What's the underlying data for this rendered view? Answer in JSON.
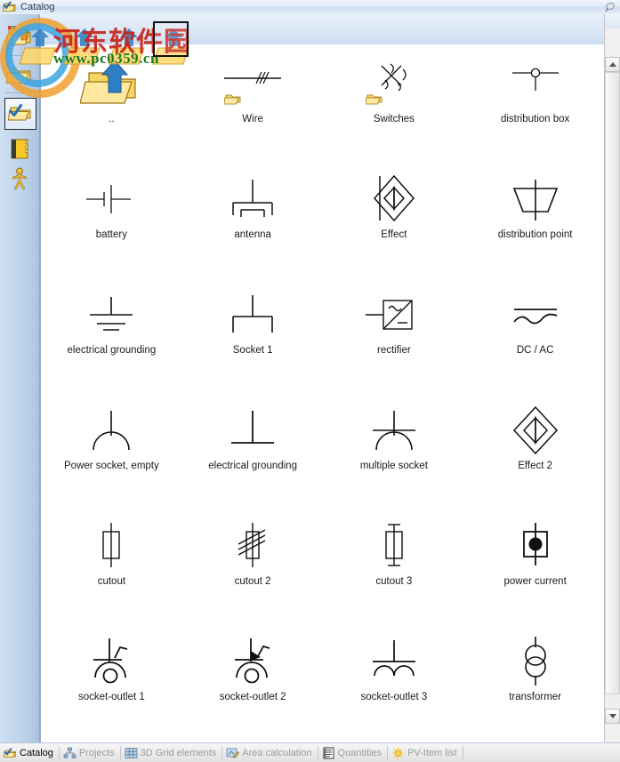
{
  "window": {
    "title": "Catalog",
    "title_icon": "folder-check-icon",
    "help_icon": "help-pointer-icon"
  },
  "sidebar": {
    "items": [
      {
        "name": "import-folder",
        "icon": "folder-import-icon",
        "selected": false
      },
      {
        "name": "open-folder",
        "icon": "folder-open-icon",
        "selected": false
      },
      {
        "name": "catalog",
        "icon": "folder-check-icon",
        "selected": true
      },
      {
        "name": "book",
        "icon": "book-icon",
        "selected": false
      },
      {
        "name": "person",
        "icon": "person-icon",
        "selected": false
      }
    ]
  },
  "catalog": {
    "items": [
      {
        "label": "..",
        "symbol": "parent-folder",
        "badge": false
      },
      {
        "label": "Wire",
        "symbol": "wire",
        "badge": true
      },
      {
        "label": "Switches",
        "symbol": "switches",
        "badge": true
      },
      {
        "label": "distribution box",
        "symbol": "distribution-box",
        "badge": false
      },
      {
        "label": "battery",
        "symbol": "battery",
        "badge": false
      },
      {
        "label": "antenna",
        "symbol": "antenna",
        "badge": false
      },
      {
        "label": "Effect",
        "symbol": "effect",
        "badge": false
      },
      {
        "label": "distribution point",
        "symbol": "distribution-point",
        "badge": false
      },
      {
        "label": "electrical grounding",
        "symbol": "electrical-grounding",
        "badge": false
      },
      {
        "label": "Socket 1",
        "symbol": "socket-1",
        "badge": false
      },
      {
        "label": "rectifier",
        "symbol": "rectifier",
        "badge": false
      },
      {
        "label": "DC / AC",
        "symbol": "dc-ac",
        "badge": false
      },
      {
        "label": "Power socket, empty",
        "symbol": "power-socket-empty",
        "badge": false
      },
      {
        "label": "electrical grounding",
        "symbol": "electrical-grounding-2",
        "badge": false
      },
      {
        "label": "multiple socket",
        "symbol": "multiple-socket",
        "badge": false
      },
      {
        "label": "Effect 2",
        "symbol": "effect-2",
        "badge": false
      },
      {
        "label": "cutout",
        "symbol": "cutout",
        "badge": false
      },
      {
        "label": "cutout 2",
        "symbol": "cutout-2",
        "badge": false
      },
      {
        "label": "cutout 3",
        "symbol": "cutout-3",
        "badge": false
      },
      {
        "label": "power current",
        "symbol": "power-current",
        "badge": false
      },
      {
        "label": "socket-outlet 1",
        "symbol": "socket-outlet-1",
        "badge": false
      },
      {
        "label": "socket-outlet 2",
        "symbol": "socket-outlet-2",
        "badge": false
      },
      {
        "label": "socket-outlet 3",
        "symbol": "socket-outlet-3",
        "badge": false
      },
      {
        "label": "transformer",
        "symbol": "transformer",
        "badge": false
      }
    ]
  },
  "scrollbar": {
    "up_arrow": "▲",
    "down_arrow": "▼"
  },
  "tabs": [
    {
      "label": "Catalog",
      "icon": "folder-check-icon",
      "active": true
    },
    {
      "label": "Projects",
      "icon": "hierarchy-icon",
      "active": false
    },
    {
      "label": "3D Grid elements",
      "icon": "grid-icon",
      "active": false
    },
    {
      "label": "Area calculation",
      "icon": "area-icon",
      "active": false
    },
    {
      "label": "Quantities",
      "icon": "list-icon",
      "active": false
    },
    {
      "label": "PV-Item list",
      "icon": "sun-icon",
      "active": false
    }
  ],
  "watermark": {
    "text_cn": "河东软件园",
    "url": "www.pc0359.cn"
  },
  "colors": {
    "accent": "#f5c53c",
    "title_text": "#20334a",
    "symbol_stroke": "#111111",
    "tab_inactive": "#9b9b9b"
  }
}
